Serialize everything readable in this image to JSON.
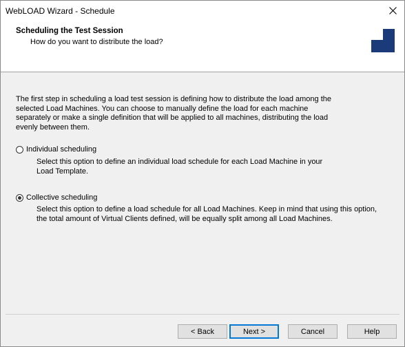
{
  "window": {
    "title": "WebLOAD Wizard - Schedule"
  },
  "header": {
    "title": "Scheduling the Test Session",
    "subtitle": "How do you want to distribute the load?"
  },
  "intro": {
    "lines": [
      "The first step in scheduling a load test session is defining how to distribute the load among the",
      "selected Load Machines. You can choose to manually define the load for each machine",
      "separately or make a single definition that will be applied to all machines, distributing the load",
      "evenly between them."
    ]
  },
  "options": [
    {
      "label": "Individual scheduling",
      "checked": false,
      "desc_lines": [
        "Select this option to define an individual load schedule for each Load Machine in your",
        "Load Template."
      ]
    },
    {
      "label": "Collective scheduling",
      "checked": true,
      "desc_lines": [
        "Select this option to define a load schedule for all Load Machines. Keep in mind that using this option,",
        "the total amount of Virtual Clients defined, will be equally split among all Load Machines."
      ]
    }
  ],
  "buttons": {
    "back": "< Back",
    "next": "Next >",
    "cancel": "Cancel",
    "help": "Help"
  },
  "colors": {
    "logo": "#1a3a7a",
    "accent": "#0078d7"
  }
}
